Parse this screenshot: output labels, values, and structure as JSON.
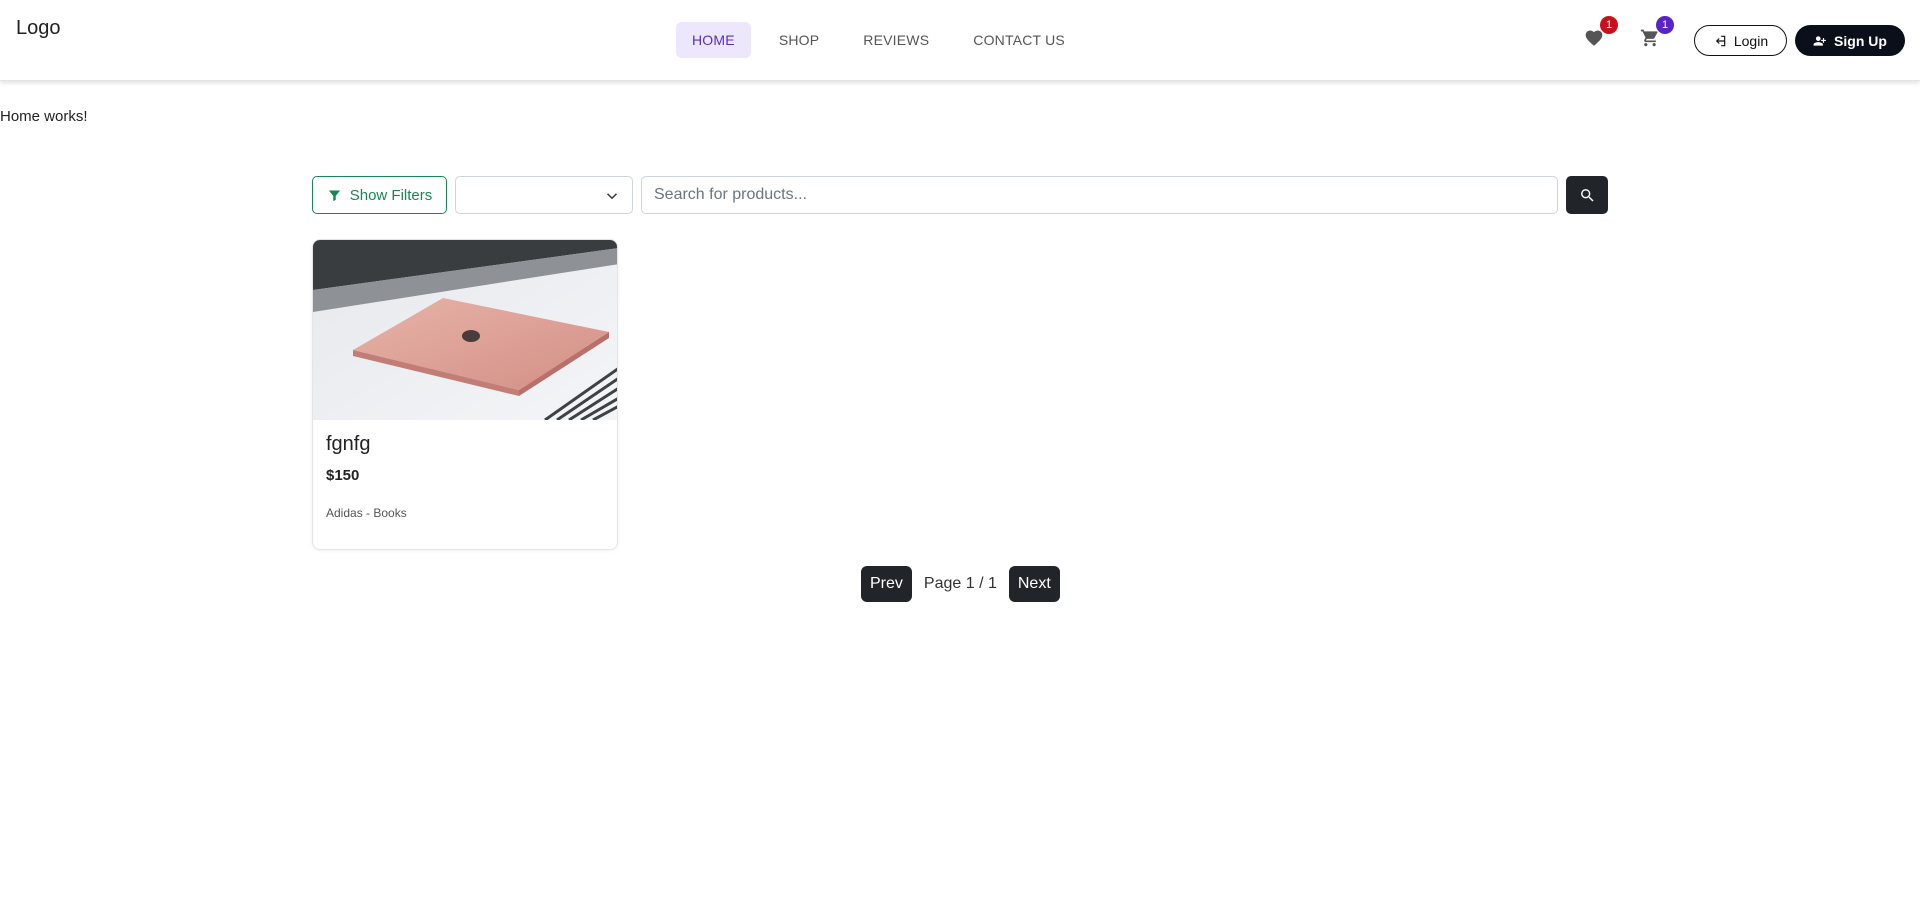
{
  "header": {
    "logo_alt": "Logo",
    "nav": [
      {
        "label": "HOME",
        "active": true
      },
      {
        "label": "SHOP",
        "active": false
      },
      {
        "label": "REVIEWS",
        "active": false
      },
      {
        "label": "CONTACT US",
        "active": false
      }
    ],
    "wishlist_count": "1",
    "cart_count": "1",
    "login_label": "Login",
    "signup_label": "Sign Up"
  },
  "main": {
    "home_text": "Home works!",
    "filters_label": "Show Filters",
    "sort_value": "",
    "search_placeholder": "Search for products...",
    "search_value": ""
  },
  "products": [
    {
      "title": "fgnfg",
      "price": "$150",
      "meta": "Adidas - Books"
    }
  ],
  "pagination": {
    "prev_label": "Prev",
    "page_text": "Page 1 / 1",
    "next_label": "Next"
  },
  "colors": {
    "accent_purple": "#5b2bc4",
    "success_green": "#198754",
    "dark": "#212529",
    "badge_red": "#c4141b"
  },
  "icons": {
    "wishlist": "heart-icon",
    "cart": "cart-icon",
    "login": "sign-in-icon",
    "signup": "user-plus-icon",
    "filters": "filter-icon",
    "sort": "chevron-down-icon",
    "search": "search-icon"
  }
}
